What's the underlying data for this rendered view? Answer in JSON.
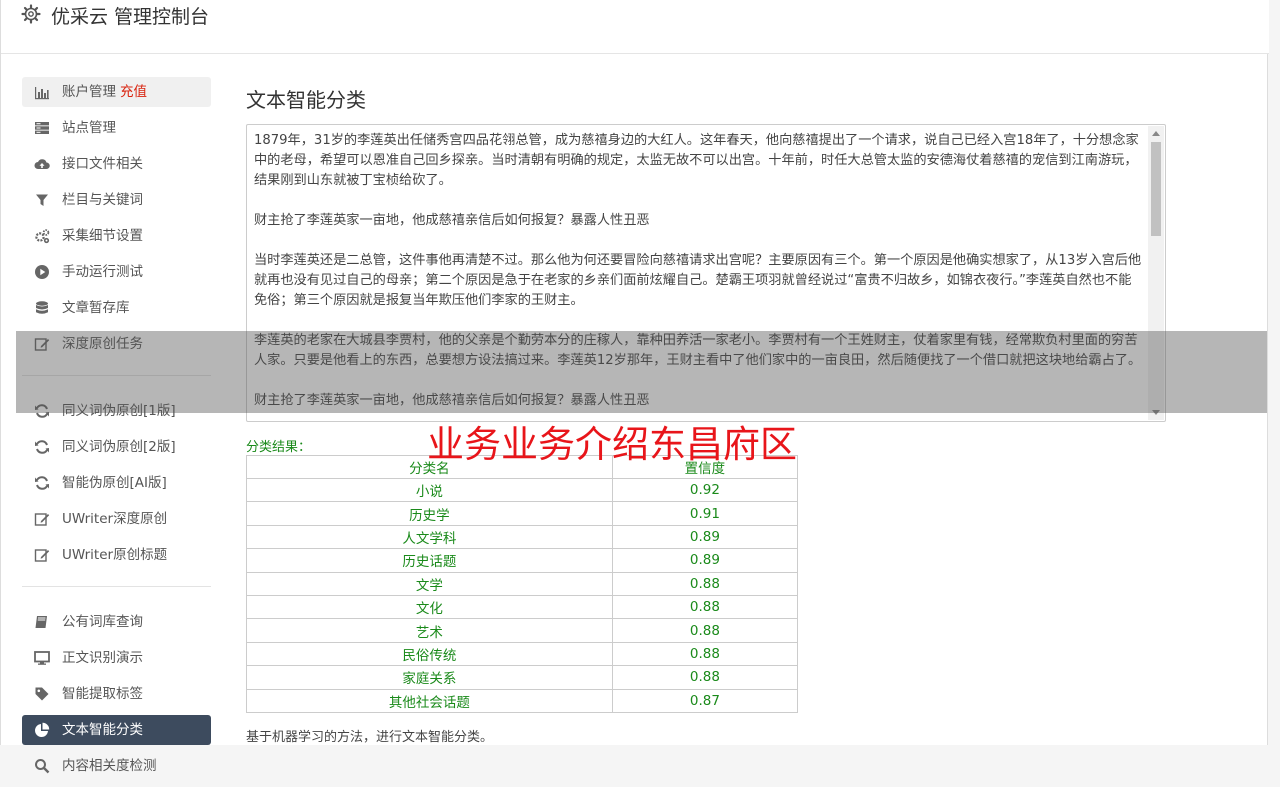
{
  "header": {
    "title": "优采云 管理控制台",
    "icon": "gear-icon"
  },
  "sidebar": {
    "items": [
      {
        "label": "账户管理",
        "extra": "充值",
        "icon": "bar-chart-icon"
      },
      {
        "label": "站点管理",
        "icon": "server-icon"
      },
      {
        "label": "接口文件相关",
        "icon": "cloud-upload-icon"
      },
      {
        "label": "栏目与关键词",
        "icon": "filter-icon"
      },
      {
        "label": "采集细节设置",
        "icon": "gears-icon"
      },
      {
        "label": "手动运行测试",
        "icon": "play-circle-icon"
      },
      {
        "label": "文章暂存库",
        "icon": "database-icon"
      },
      {
        "label": "深度原创任务",
        "icon": "edit-icon"
      },
      {
        "label": "同义词伪原创[1版]",
        "icon": "refresh-icon"
      },
      {
        "label": "同义词伪原创[2版]",
        "icon": "refresh-icon"
      },
      {
        "label": "智能伪原创[AI版]",
        "icon": "refresh-icon"
      },
      {
        "label": "UWriter深度原创",
        "icon": "edit-icon"
      },
      {
        "label": "UWriter原创标题",
        "icon": "edit-icon"
      },
      {
        "label": "公有词库查询",
        "icon": "book-icon"
      },
      {
        "label": "正文识别演示",
        "icon": "monitor-icon"
      },
      {
        "label": "智能提取标签",
        "icon": "tag-icon"
      },
      {
        "label": "文本智能分类",
        "icon": "pie-chart-icon"
      },
      {
        "label": "内容相关度检测",
        "icon": "search-icon"
      }
    ]
  },
  "main": {
    "title": "文本智能分类",
    "text": "1879年，31岁的李莲英出任储秀宫四品花翎总管，成为慈禧身边的大红人。这年春天，他向慈禧提出了一个请求，说自己已经入宫18年了，十分想念家中的老母，希望可以恩准自己回乡探亲。当时清朝有明确的规定，太监无故不可以出宫。十年前，时任大总管太监的安德海仗着慈禧的宠信到江南游玩，结果刚到山东就被丁宝桢给砍了。\n\n财主抢了李莲英家一亩地，他成慈禧亲信后如何报复？暴露人性丑恶\n\n当时李莲英还是二总管，这件事他再清楚不过。那么他为何还要冒险向慈禧请求出宫呢？主要原因有三个。第一个原因是他确实想家了，从13岁入宫后他就再也没有见过自己的母亲；第二个原因是急于在老家的乡亲们面前炫耀自己。楚霸王项羽就曾经说过“富贵不归故乡，如锦衣夜行。”李莲英自然也不能免俗；第三个原因就是报复当年欺压他们李家的王财主。\n\n李莲英的老家在大城县李贾村，他的父亲是个勤劳本分的庄稼人，靠种田养活一家老小。李贾村有一个王姓财主，仗着家里有钱，经常欺负村里面的穷苦人家。只要是他看上的东西，总要想方设法搞过来。李莲英12岁那年，王财主看中了他们家中的一亩良田，然后随便找了一个借口就把这块地给霸占了。\n\n财主抢了李莲英家一亩地，他成慈禧亲信后如何报复？暴露人性丑恶",
    "result_label": "分类结果：",
    "table": {
      "headers": [
        "分类名",
        "置信度"
      ],
      "rows": [
        [
          "小说",
          "0.92"
        ],
        [
          "历史学",
          "0.91"
        ],
        [
          "人文学科",
          "0.89"
        ],
        [
          "历史话题",
          "0.89"
        ],
        [
          "文学",
          "0.88"
        ],
        [
          "文化",
          "0.88"
        ],
        [
          "艺术",
          "0.88"
        ],
        [
          "民俗传统",
          "0.88"
        ],
        [
          "家庭关系",
          "0.88"
        ],
        [
          "其他社会话题",
          "0.87"
        ]
      ]
    },
    "footnote": "基于机器学习的方法，进行文本智能分类。"
  },
  "watermark": "业务业务介绍东昌府区",
  "colors": {
    "accent_red": "#d9230f",
    "result_green": "#1a8a1a",
    "active_nav": "#3d4b5e",
    "watermark_red": "#e8151a"
  }
}
